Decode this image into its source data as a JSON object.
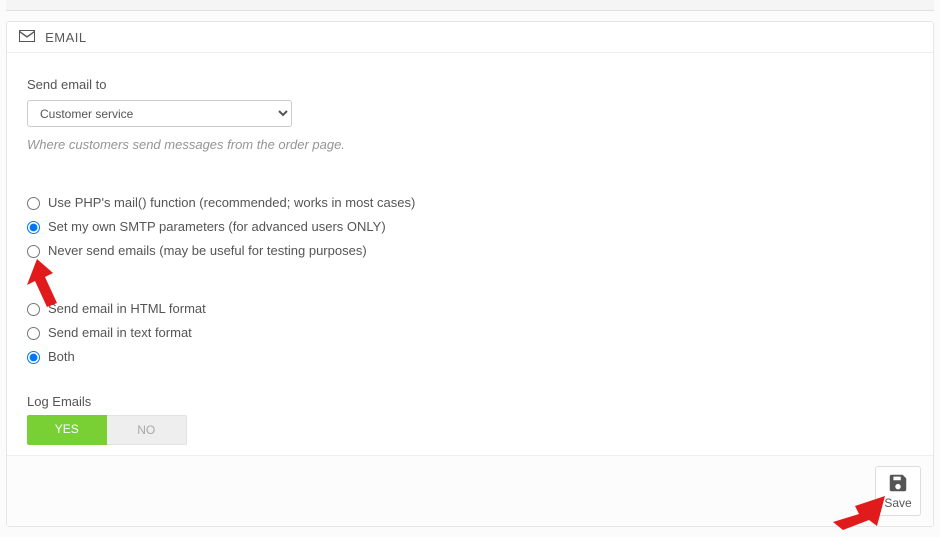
{
  "panel": {
    "title": "EMAIL"
  },
  "send_to": {
    "label": "Send email to",
    "selected": "Customer service",
    "help": "Where customers send messages from the order page."
  },
  "mail_method": {
    "options": [
      {
        "label": "Use PHP's mail() function (recommended; works in most cases)",
        "checked": false
      },
      {
        "label": "Set my own SMTP parameters (for advanced users ONLY)",
        "checked": true
      },
      {
        "label": "Never send emails (may be useful for testing purposes)",
        "checked": false
      }
    ]
  },
  "mail_format": {
    "options": [
      {
        "label": "Send email in HTML format",
        "checked": false
      },
      {
        "label": "Send email in text format",
        "checked": false
      },
      {
        "label": "Both",
        "checked": true
      }
    ]
  },
  "log": {
    "label": "Log Emails",
    "yes": "YES",
    "no": "NO"
  },
  "footer": {
    "save": "Save"
  }
}
